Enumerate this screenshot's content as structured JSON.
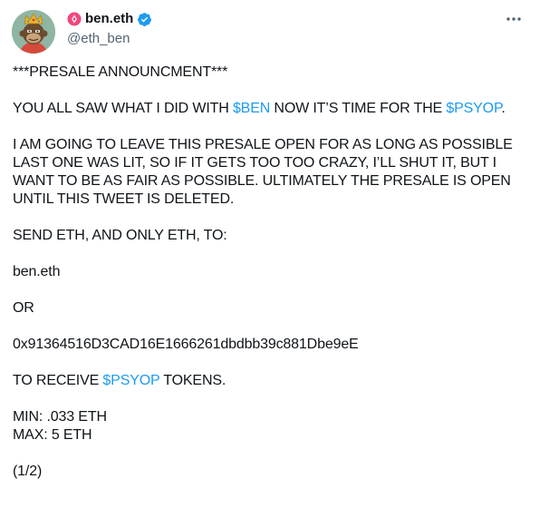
{
  "author": {
    "name": "ben.eth",
    "handle": "@eth_ben",
    "avatar_icon": "crowned-ape-avatar",
    "verified_color": "#1d9bf0"
  },
  "more_icon": "more-horizontal-icon",
  "tweet": {
    "line1": "***PRESALE ANNOUNCMENT***",
    "p2_a": "YOU ALL SAW WHAT I DID WITH ",
    "p2_link1": "$BEN",
    "p2_b": " NOW IT’S TIME FOR THE ",
    "p2_link2": "$PSYOP",
    "p2_c": ".",
    "p3": "I AM GOING TO LEAVE THIS PRESALE OPEN FOR AS LONG AS POSSIBLE LAST ONE WAS LIT, SO IF IT GETS TOO TOO CRAZY, I’LL SHUT IT, BUT I WANT TO BE AS FAIR AS POSSIBLE. ULTIMATELY THE PRESALE IS OPEN UNTIL THIS TWEET IS DELETED.",
    "p4": "SEND ETH, AND ONLY ETH, TO:",
    "p5": "ben.eth",
    "p6": "OR",
    "p7": "0x91364516D3CAD16E1666261dbdbb39c881Dbe9eE",
    "p8_a": "TO RECEIVE ",
    "p8_link": "$PSYOP",
    "p8_b": " TOKENS.",
    "min": "MIN: .033 ETH",
    "max": "MAX: 5 ETH",
    "page": "(1/2)"
  }
}
